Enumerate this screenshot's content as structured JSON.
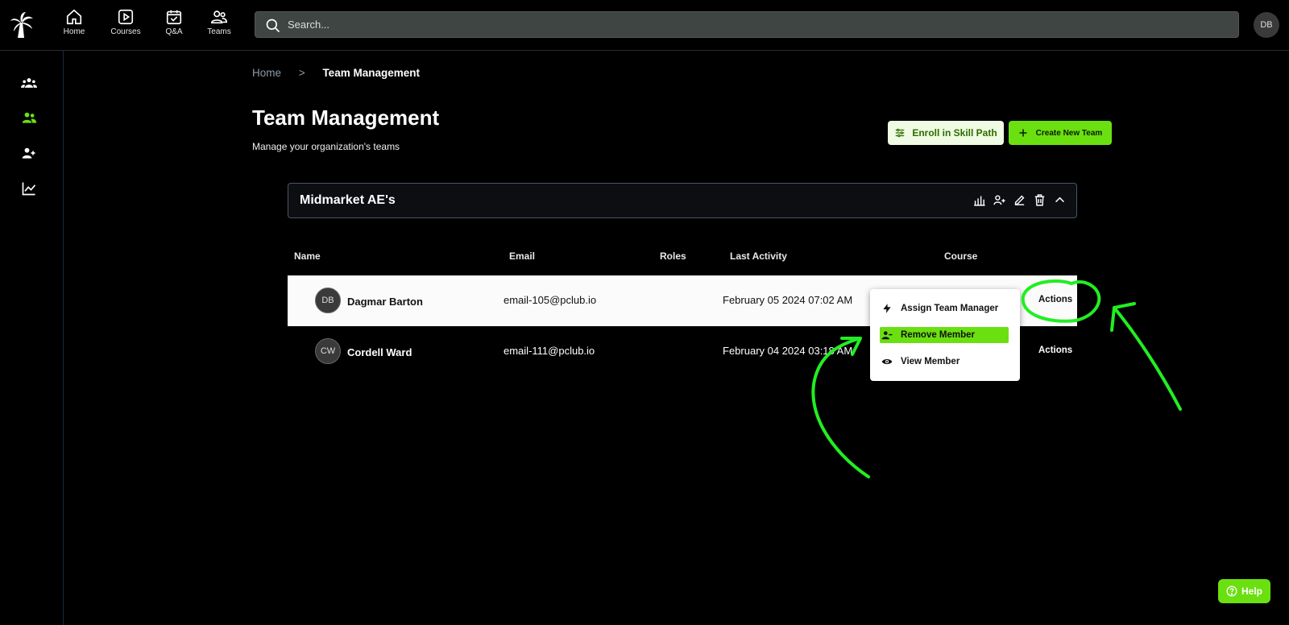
{
  "nav": {
    "items": [
      {
        "label": "Home",
        "icon": "home-icon"
      },
      {
        "label": "Courses",
        "icon": "play-icon"
      },
      {
        "label": "Q&A",
        "icon": "calendar-check-icon"
      },
      {
        "label": "Teams",
        "icon": "users-icon"
      }
    ],
    "search_placeholder": "Search...",
    "user_initials": "DB"
  },
  "breadcrumb": {
    "home": "Home",
    "separator": ">",
    "current": "Team Management"
  },
  "page": {
    "title": "Team Management",
    "subtitle": "Manage your organization's teams",
    "enroll_label": "Enroll in Skill Path",
    "create_label": "Create New Team"
  },
  "team": {
    "name": "Midmarket AE's"
  },
  "table": {
    "headers": [
      "Name",
      "Email",
      "Roles",
      "Last Activity",
      "Course"
    ],
    "rows": [
      {
        "initials": "DB",
        "name": "Dagmar Barton",
        "email": "email-105@pclub.io",
        "activity": "February 05 2024 07:02 AM",
        "actions": "Actions"
      },
      {
        "initials": "CW",
        "name": "Cordell Ward",
        "email": "email-111@pclub.io",
        "activity": "February 04 2024 03:18 AM",
        "actions": "Actions"
      }
    ]
  },
  "menu": {
    "items": [
      {
        "label": "Assign Team Manager",
        "icon": "lightning-icon"
      },
      {
        "label": "Remove Member",
        "icon": "user-minus-icon"
      },
      {
        "label": "View Member",
        "icon": "eye-icon"
      }
    ]
  },
  "help_label": "Help",
  "colors": {
    "accent": "#6be011",
    "background": "#000000",
    "annotation": "#22ee22"
  }
}
